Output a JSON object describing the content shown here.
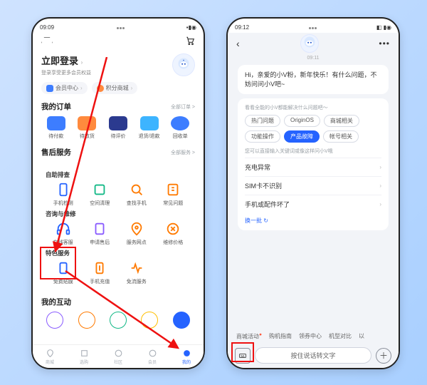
{
  "left": {
    "status": {
      "time": "09:09"
    },
    "login": {
      "title": "立即登录",
      "subtitle": "登录享受更多会员权益"
    },
    "pills": [
      {
        "label": "会员中心",
        "color": "#3d7dff"
      },
      {
        "label": "积分商城",
        "color": "#ff8a3d"
      }
    ],
    "orders": {
      "title": "我的订单",
      "more": "全部订单 >",
      "items": [
        {
          "label": "待付款"
        },
        {
          "label": "待收货"
        },
        {
          "label": "待评价"
        },
        {
          "label": "退货/退款"
        },
        {
          "label": "回收单"
        }
      ]
    },
    "aftersale": {
      "title": "售后服务",
      "more": "全部服务 >",
      "groups": [
        {
          "title": "自助排查",
          "items": [
            {
              "label": "手机检测"
            },
            {
              "label": "空间清理"
            },
            {
              "label": "查找手机"
            },
            {
              "label": "常见问题"
            }
          ]
        },
        {
          "title": "咨询与维修",
          "items": [
            {
              "label": "在线客服"
            },
            {
              "label": "申请售后"
            },
            {
              "label": "服务网点"
            },
            {
              "label": "维修价格"
            }
          ]
        },
        {
          "title": "特色服务",
          "items": [
            {
              "label": "免费贴膜"
            },
            {
              "label": "手机充值"
            },
            {
              "label": "免流服务"
            }
          ]
        }
      ]
    },
    "interact": {
      "title": "我的互动"
    },
    "tabs": [
      {
        "label": "商城"
      },
      {
        "label": "选购"
      },
      {
        "label": "社区"
      },
      {
        "label": "会员"
      },
      {
        "label": "我的"
      }
    ]
  },
  "right": {
    "status": {
      "time": "09:12"
    },
    "chat": {
      "timestamp": "09:11",
      "greeting": "Hi，亲爱的小V粉，新年快乐！有什么问题，不妨问问小V吧~",
      "guide": "看看全能的小V都能解决什么问题吧～",
      "hint": "您可以直接输入关键词或像这样问小V哦",
      "swap": "换一批 ↻"
    },
    "chips": [
      {
        "label": "热门问题"
      },
      {
        "label": "OriginOS"
      },
      {
        "label": "商城相关"
      },
      {
        "label": "功能操作"
      },
      {
        "label": "产品故障",
        "active": true
      },
      {
        "label": "帐号相关"
      }
    ],
    "faq": [
      {
        "label": "充电异常"
      },
      {
        "label": "SIM卡不识别"
      },
      {
        "label": "手机或配件坏了"
      }
    ],
    "suggestions": [
      {
        "label": "商城活动"
      },
      {
        "label": "购机指南"
      },
      {
        "label": "领券中心"
      },
      {
        "label": "机型对比"
      },
      {
        "label": "以"
      }
    ],
    "input": {
      "placeholder": "按住说话转文字"
    }
  }
}
